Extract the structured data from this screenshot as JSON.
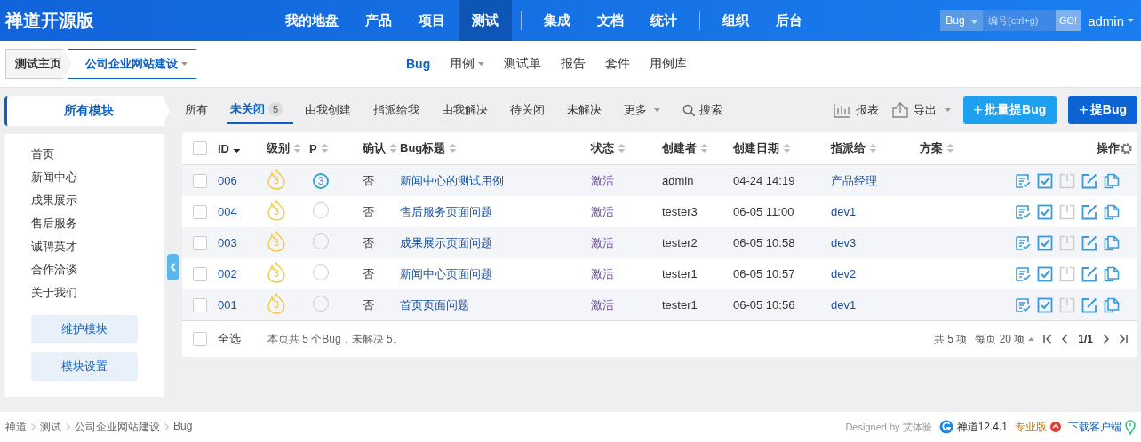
{
  "brand": "禅道开源版",
  "nav_groups": [
    [
      {
        "label": "我的地盘",
        "selected": false
      },
      {
        "label": "产品",
        "selected": false
      },
      {
        "label": "项目",
        "selected": false
      },
      {
        "label": "测试",
        "selected": true
      }
    ],
    [
      {
        "label": "集成",
        "selected": false
      },
      {
        "label": "文档",
        "selected": false
      },
      {
        "label": "统计",
        "selected": false
      }
    ],
    [
      {
        "label": "组织",
        "selected": false
      },
      {
        "label": "后台",
        "selected": false
      }
    ]
  ],
  "quick_search": {
    "type": "Bug",
    "placeholder": "编号(ctrl+g)",
    "button": "GO!"
  },
  "user": "admin",
  "crumbs": [
    {
      "label": "测试主页",
      "dropdown": false
    },
    {
      "label": "公司企业网站建设",
      "dropdown": true
    }
  ],
  "subnav": [
    {
      "label": "Bug",
      "selected": true,
      "dropdown": false
    },
    {
      "label": "用例",
      "selected": false,
      "dropdown": true
    },
    {
      "label": "测试单",
      "selected": false,
      "dropdown": false
    },
    {
      "label": "报告",
      "selected": false,
      "dropdown": false
    },
    {
      "label": "套件",
      "selected": false,
      "dropdown": false
    },
    {
      "label": "用例库",
      "selected": false,
      "dropdown": false
    }
  ],
  "sidebar": {
    "title": "所有模块",
    "modules": [
      "首页",
      "新闻中心",
      "成果展示",
      "售后服务",
      "诚聘英才",
      "合作洽谈",
      "关于我们"
    ],
    "buttons": [
      "维护模块",
      "模块设置"
    ]
  },
  "filters": [
    {
      "label": "所有",
      "selected": false
    },
    {
      "label": "未关闭",
      "selected": true,
      "count": "5"
    },
    {
      "label": "由我创建",
      "selected": false
    },
    {
      "label": "指派给我",
      "selected": false
    },
    {
      "label": "由我解决",
      "selected": false
    },
    {
      "label": "待关闭",
      "selected": false
    },
    {
      "label": "未解决",
      "selected": false
    },
    {
      "label": "更多",
      "selected": false,
      "dropdown": true
    }
  ],
  "search_label": "搜索",
  "toolbar": {
    "report": "报表",
    "export": "导出",
    "batch_create": "批量提Bug",
    "create": "提Bug",
    "plus": "+"
  },
  "columns": [
    {
      "label": "ID",
      "sortable": true,
      "sorted_desc": true
    },
    {
      "label": "级别",
      "sortable": true,
      "sorted_desc": false
    },
    {
      "label": "P",
      "sortable": true,
      "sorted_desc": false
    },
    {
      "label": "确认",
      "sortable": true,
      "sorted_desc": false
    },
    {
      "label": "Bug标题",
      "sortable": true,
      "sorted_desc": false
    },
    {
      "label": "状态",
      "sortable": true,
      "sorted_desc": false
    },
    {
      "label": "创建者",
      "sortable": true,
      "sorted_desc": false
    },
    {
      "label": "创建日期",
      "sortable": true,
      "sorted_desc": false
    },
    {
      "label": "指派给",
      "sortable": true,
      "sorted_desc": false
    },
    {
      "label": "方案",
      "sortable": true,
      "sorted_desc": false
    },
    {
      "label": "操作"
    }
  ],
  "table_header": {
    "checked": false
  },
  "rows": [
    {
      "id": "006",
      "severity": "3",
      "priority": "3",
      "confirmed": "否",
      "title": "新闻中心的测试用例",
      "status": "激活",
      "creator": "admin",
      "date": "04-24 14:19",
      "assignee": "产品经理",
      "checked": false,
      "close_disabled": true
    },
    {
      "id": "004",
      "severity": "3",
      "confirmed": "否",
      "title": "售后服务页面问题",
      "status": "激活",
      "creator": "tester3",
      "date": "06-05 11:00",
      "assignee": "dev1",
      "checked": false,
      "close_disabled": true
    },
    {
      "id": "003",
      "severity": "3",
      "confirmed": "否",
      "title": "成果展示页面问题",
      "status": "激活",
      "creator": "tester2",
      "date": "06-05 10:58",
      "assignee": "dev3",
      "checked": false,
      "close_disabled": true
    },
    {
      "id": "002",
      "severity": "3",
      "confirmed": "否",
      "title": "新闻中心页面问题",
      "status": "激活",
      "creator": "tester1",
      "date": "06-05 10:57",
      "assignee": "dev2",
      "checked": false,
      "close_disabled": true
    },
    {
      "id": "001",
      "severity": "3",
      "confirmed": "否",
      "title": "首页页面问题",
      "status": "激活",
      "creator": "tester1",
      "date": "06-05 10:56",
      "assignee": "dev1",
      "checked": false,
      "close_disabled": true
    }
  ],
  "table_footer": {
    "checked": false,
    "select_all": "全选",
    "summary": "本页共 5 个Bug，未解决 5。",
    "total": "共 5 项",
    "per_page": "每页 20 项",
    "page": "1/1"
  },
  "breadcrumb": [
    "禅道",
    "测试",
    "公司企业网站建设",
    "Bug"
  ],
  "footer": {
    "designed_by": "Designed by 艾体验",
    "version": "禅道12.4.1",
    "edition": "专业版",
    "download": "下载客户端"
  }
}
